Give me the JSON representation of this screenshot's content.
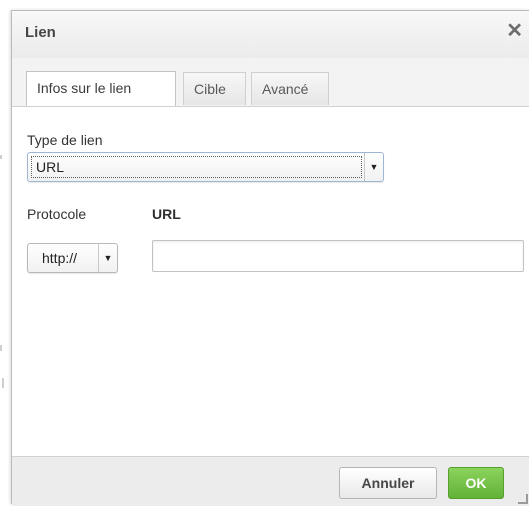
{
  "dialog": {
    "title": "Lien",
    "close_glyph": "✕"
  },
  "tabs": [
    {
      "label": "Infos sur le lien",
      "active": true
    },
    {
      "label": "Cible",
      "active": false
    },
    {
      "label": "Avancé",
      "active": false
    }
  ],
  "link_type": {
    "label": "Type de lien",
    "selected": "URL"
  },
  "protocol": {
    "label": "Protocole",
    "selected": "http://"
  },
  "url": {
    "label": "URL",
    "value": ""
  },
  "footer": {
    "cancel_label": "Annuler",
    "ok_label": "OK"
  },
  "colors": {
    "ok_button": "#6cbf41",
    "titlebar": "#f1f1f1",
    "footer": "#ececec"
  },
  "icons": {
    "close": "close-icon",
    "dropdown": "triangle-down-icon",
    "resize": "resize-grip-icon"
  }
}
